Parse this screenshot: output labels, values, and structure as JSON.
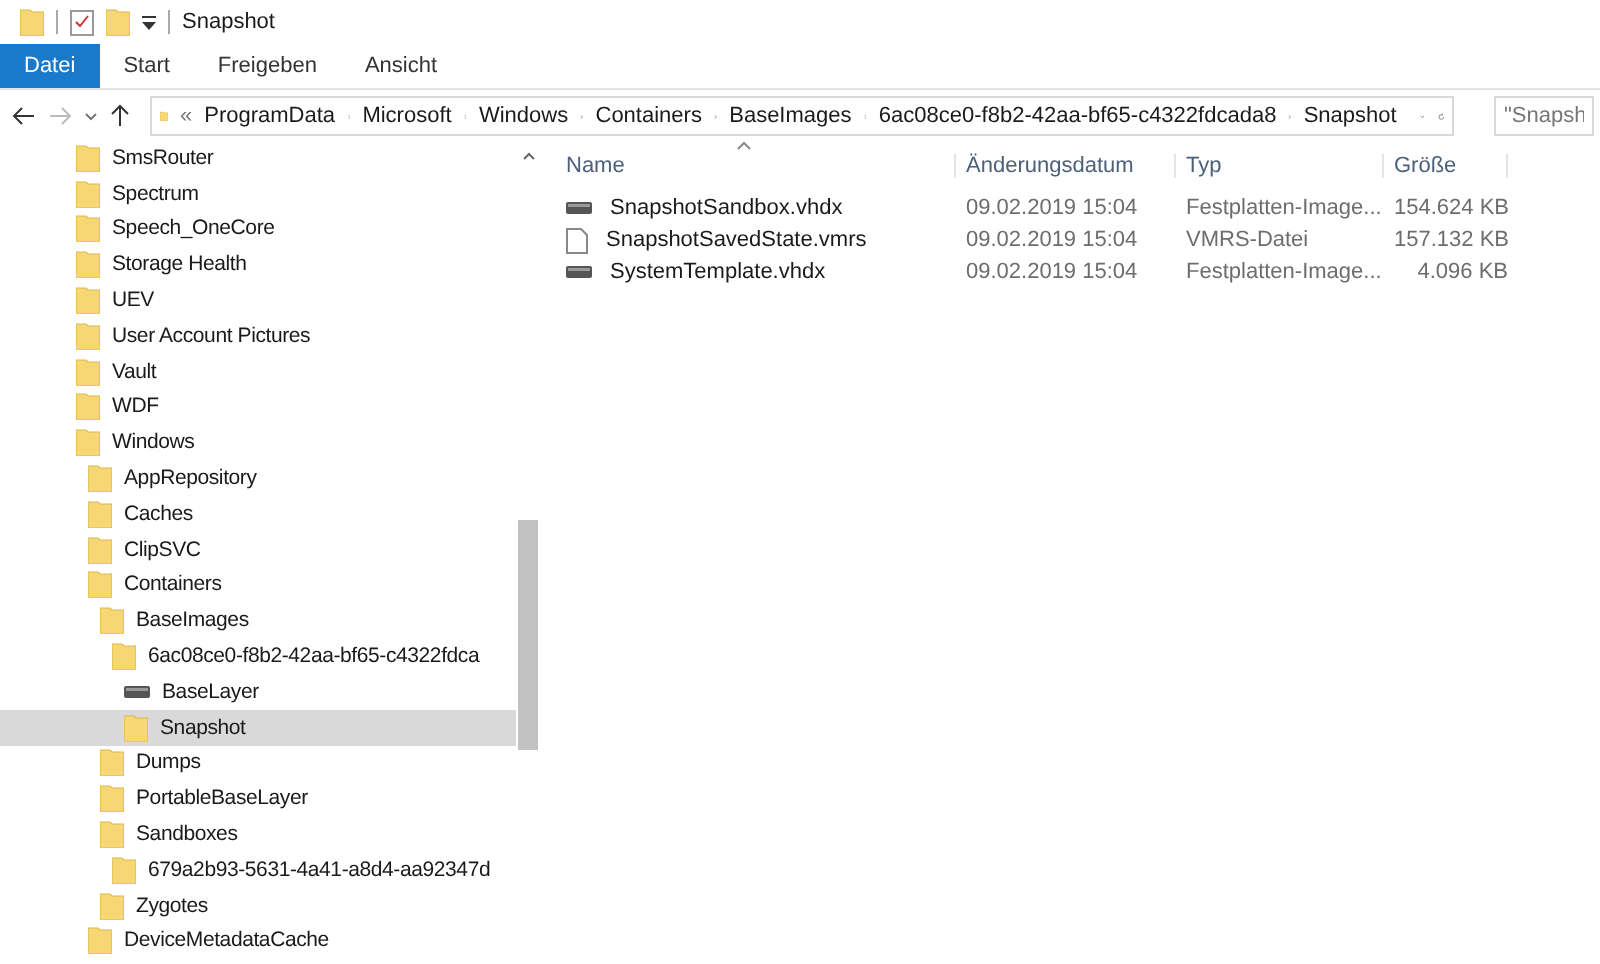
{
  "window": {
    "title": "Snapshot"
  },
  "ribbon_tabs": [
    {
      "label": "Datei",
      "selected": true
    },
    {
      "label": "Start",
      "selected": false
    },
    {
      "label": "Freigeben",
      "selected": false
    },
    {
      "label": "Ansicht",
      "selected": false
    }
  ],
  "address": {
    "overflow": "«",
    "crumbs": [
      "ProgramData",
      "Microsoft",
      "Windows",
      "Containers",
      "BaseImages",
      "6ac08ce0-f8b2-42aa-bf65-c4322fdcada8",
      "Snapshot"
    ]
  },
  "search": {
    "placeholder": "\"Snapsh"
  },
  "tree": [
    {
      "name": "SmsRouter",
      "kind": "folder",
      "selected": false
    },
    {
      "name": "Spectrum",
      "kind": "folder",
      "selected": false
    },
    {
      "name": "Speech_OneCore",
      "kind": "folder",
      "selected": false
    },
    {
      "name": "Storage Health",
      "kind": "folder",
      "selected": false
    },
    {
      "name": "UEV",
      "kind": "folder",
      "selected": false
    },
    {
      "name": "User Account Pictures",
      "kind": "folder",
      "selected": false
    },
    {
      "name": "Vault",
      "kind": "folder",
      "selected": false
    },
    {
      "name": "WDF",
      "kind": "folder",
      "selected": false
    },
    {
      "name": "Windows",
      "kind": "folder",
      "selected": false,
      "children": [
        {
          "name": "AppRepository",
          "kind": "folder",
          "selected": false
        },
        {
          "name": "Caches",
          "kind": "folder",
          "selected": false
        },
        {
          "name": "ClipSVC",
          "kind": "folder",
          "selected": false
        },
        {
          "name": "Containers",
          "kind": "folder",
          "selected": false,
          "children": [
            {
              "name": "BaseImages",
              "kind": "folder",
              "selected": false,
              "children": [
                {
                  "name": "6ac08ce0-f8b2-42aa-bf65-c4322fdca",
                  "kind": "folder",
                  "selected": false,
                  "children": [
                    {
                      "name": "BaseLayer",
                      "kind": "drive",
                      "selected": false
                    },
                    {
                      "name": "Snapshot",
                      "kind": "folder",
                      "selected": true
                    }
                  ]
                }
              ]
            },
            {
              "name": "Dumps",
              "kind": "folder",
              "selected": false
            },
            {
              "name": "PortableBaseLayer",
              "kind": "folder",
              "selected": false
            },
            {
              "name": "Sandboxes",
              "kind": "folder",
              "selected": false,
              "children": [
                {
                  "name": "679a2b93-5631-4a41-a8d4-aa92347d",
                  "kind": "folder",
                  "selected": false
                }
              ]
            },
            {
              "name": "Zygotes",
              "kind": "folder",
              "selected": false
            }
          ]
        },
        {
          "name": "DeviceMetadataCache",
          "kind": "folder",
          "selected": false
        }
      ]
    }
  ],
  "table": {
    "columns": [
      "Name",
      "Änderungsdatum",
      "Typ",
      "Größe"
    ],
    "rows": [
      {
        "kind": "drive",
        "cells": [
          "SnapshotSandbox.vhdx",
          "09.02.2019 15:04",
          "Festplatten-Image...",
          "154.624 KB"
        ]
      },
      {
        "kind": "file",
        "cells": [
          "SnapshotSavedState.vmrs",
          "09.02.2019 15:04",
          "VMRS-Datei",
          "157.132 KB"
        ]
      },
      {
        "kind": "drive",
        "cells": [
          "SystemTemplate.vhdx",
          "09.02.2019 15:04",
          "Festplatten-Image...",
          "4.096 KB"
        ]
      }
    ]
  }
}
